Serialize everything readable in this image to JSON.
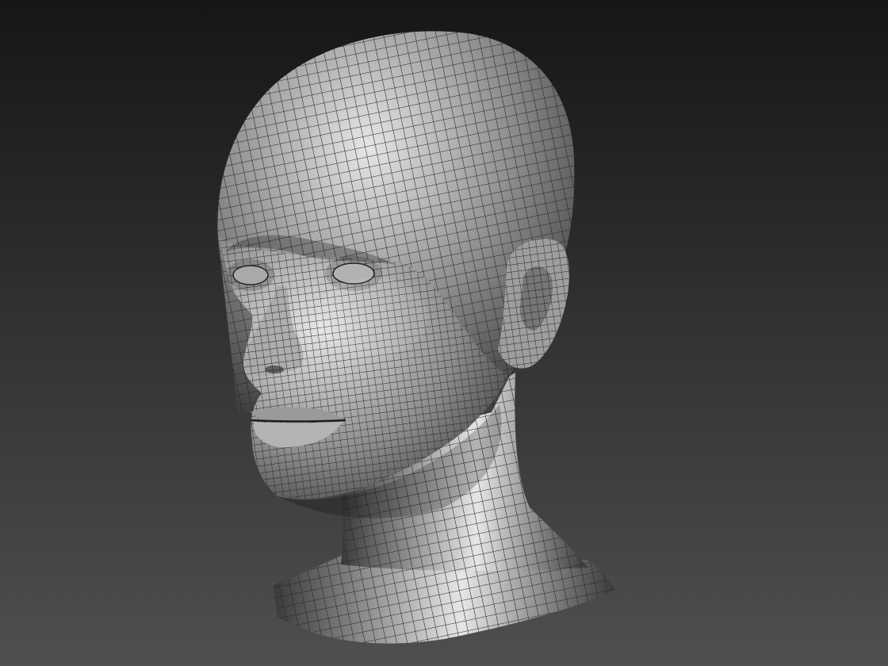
{
  "scene": {
    "subject": "head-mesh",
    "background_top": "#161616",
    "background_bottom": "#4f4f4f",
    "mesh_base": "#8c8c8c",
    "mesh_highlight": "#e6e6e6",
    "mesh_shadow": "#3a3a3a",
    "wire_color": "#242424"
  }
}
